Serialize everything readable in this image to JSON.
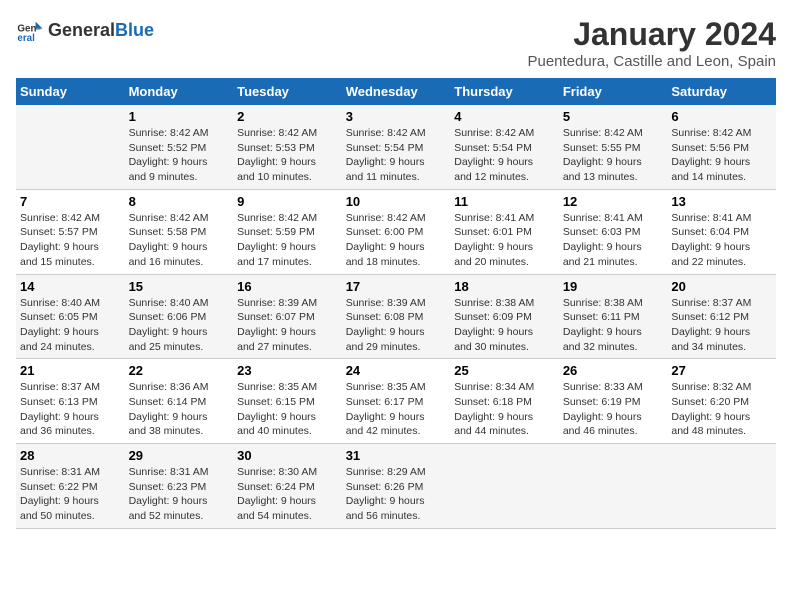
{
  "logo": {
    "general": "General",
    "blue": "Blue"
  },
  "header": {
    "month": "January 2024",
    "location": "Puentedura, Castille and Leon, Spain"
  },
  "weekdays": [
    "Sunday",
    "Monday",
    "Tuesday",
    "Wednesday",
    "Thursday",
    "Friday",
    "Saturday"
  ],
  "weeks": [
    [
      {
        "day": "",
        "detail": ""
      },
      {
        "day": "1",
        "detail": "Sunrise: 8:42 AM\nSunset: 5:52 PM\nDaylight: 9 hours\nand 9 minutes."
      },
      {
        "day": "2",
        "detail": "Sunrise: 8:42 AM\nSunset: 5:53 PM\nDaylight: 9 hours\nand 10 minutes."
      },
      {
        "day": "3",
        "detail": "Sunrise: 8:42 AM\nSunset: 5:54 PM\nDaylight: 9 hours\nand 11 minutes."
      },
      {
        "day": "4",
        "detail": "Sunrise: 8:42 AM\nSunset: 5:54 PM\nDaylight: 9 hours\nand 12 minutes."
      },
      {
        "day": "5",
        "detail": "Sunrise: 8:42 AM\nSunset: 5:55 PM\nDaylight: 9 hours\nand 13 minutes."
      },
      {
        "day": "6",
        "detail": "Sunrise: 8:42 AM\nSunset: 5:56 PM\nDaylight: 9 hours\nand 14 minutes."
      }
    ],
    [
      {
        "day": "7",
        "detail": "Sunrise: 8:42 AM\nSunset: 5:57 PM\nDaylight: 9 hours\nand 15 minutes."
      },
      {
        "day": "8",
        "detail": "Sunrise: 8:42 AM\nSunset: 5:58 PM\nDaylight: 9 hours\nand 16 minutes."
      },
      {
        "day": "9",
        "detail": "Sunrise: 8:42 AM\nSunset: 5:59 PM\nDaylight: 9 hours\nand 17 minutes."
      },
      {
        "day": "10",
        "detail": "Sunrise: 8:42 AM\nSunset: 6:00 PM\nDaylight: 9 hours\nand 18 minutes."
      },
      {
        "day": "11",
        "detail": "Sunrise: 8:41 AM\nSunset: 6:01 PM\nDaylight: 9 hours\nand 20 minutes."
      },
      {
        "day": "12",
        "detail": "Sunrise: 8:41 AM\nSunset: 6:03 PM\nDaylight: 9 hours\nand 21 minutes."
      },
      {
        "day": "13",
        "detail": "Sunrise: 8:41 AM\nSunset: 6:04 PM\nDaylight: 9 hours\nand 22 minutes."
      }
    ],
    [
      {
        "day": "14",
        "detail": "Sunrise: 8:40 AM\nSunset: 6:05 PM\nDaylight: 9 hours\nand 24 minutes."
      },
      {
        "day": "15",
        "detail": "Sunrise: 8:40 AM\nSunset: 6:06 PM\nDaylight: 9 hours\nand 25 minutes."
      },
      {
        "day": "16",
        "detail": "Sunrise: 8:39 AM\nSunset: 6:07 PM\nDaylight: 9 hours\nand 27 minutes."
      },
      {
        "day": "17",
        "detail": "Sunrise: 8:39 AM\nSunset: 6:08 PM\nDaylight: 9 hours\nand 29 minutes."
      },
      {
        "day": "18",
        "detail": "Sunrise: 8:38 AM\nSunset: 6:09 PM\nDaylight: 9 hours\nand 30 minutes."
      },
      {
        "day": "19",
        "detail": "Sunrise: 8:38 AM\nSunset: 6:11 PM\nDaylight: 9 hours\nand 32 minutes."
      },
      {
        "day": "20",
        "detail": "Sunrise: 8:37 AM\nSunset: 6:12 PM\nDaylight: 9 hours\nand 34 minutes."
      }
    ],
    [
      {
        "day": "21",
        "detail": "Sunrise: 8:37 AM\nSunset: 6:13 PM\nDaylight: 9 hours\nand 36 minutes."
      },
      {
        "day": "22",
        "detail": "Sunrise: 8:36 AM\nSunset: 6:14 PM\nDaylight: 9 hours\nand 38 minutes."
      },
      {
        "day": "23",
        "detail": "Sunrise: 8:35 AM\nSunset: 6:15 PM\nDaylight: 9 hours\nand 40 minutes."
      },
      {
        "day": "24",
        "detail": "Sunrise: 8:35 AM\nSunset: 6:17 PM\nDaylight: 9 hours\nand 42 minutes."
      },
      {
        "day": "25",
        "detail": "Sunrise: 8:34 AM\nSunset: 6:18 PM\nDaylight: 9 hours\nand 44 minutes."
      },
      {
        "day": "26",
        "detail": "Sunrise: 8:33 AM\nSunset: 6:19 PM\nDaylight: 9 hours\nand 46 minutes."
      },
      {
        "day": "27",
        "detail": "Sunrise: 8:32 AM\nSunset: 6:20 PM\nDaylight: 9 hours\nand 48 minutes."
      }
    ],
    [
      {
        "day": "28",
        "detail": "Sunrise: 8:31 AM\nSunset: 6:22 PM\nDaylight: 9 hours\nand 50 minutes."
      },
      {
        "day": "29",
        "detail": "Sunrise: 8:31 AM\nSunset: 6:23 PM\nDaylight: 9 hours\nand 52 minutes."
      },
      {
        "day": "30",
        "detail": "Sunrise: 8:30 AM\nSunset: 6:24 PM\nDaylight: 9 hours\nand 54 minutes."
      },
      {
        "day": "31",
        "detail": "Sunrise: 8:29 AM\nSunset: 6:26 PM\nDaylight: 9 hours\nand 56 minutes."
      },
      {
        "day": "",
        "detail": ""
      },
      {
        "day": "",
        "detail": ""
      },
      {
        "day": "",
        "detail": ""
      }
    ]
  ]
}
